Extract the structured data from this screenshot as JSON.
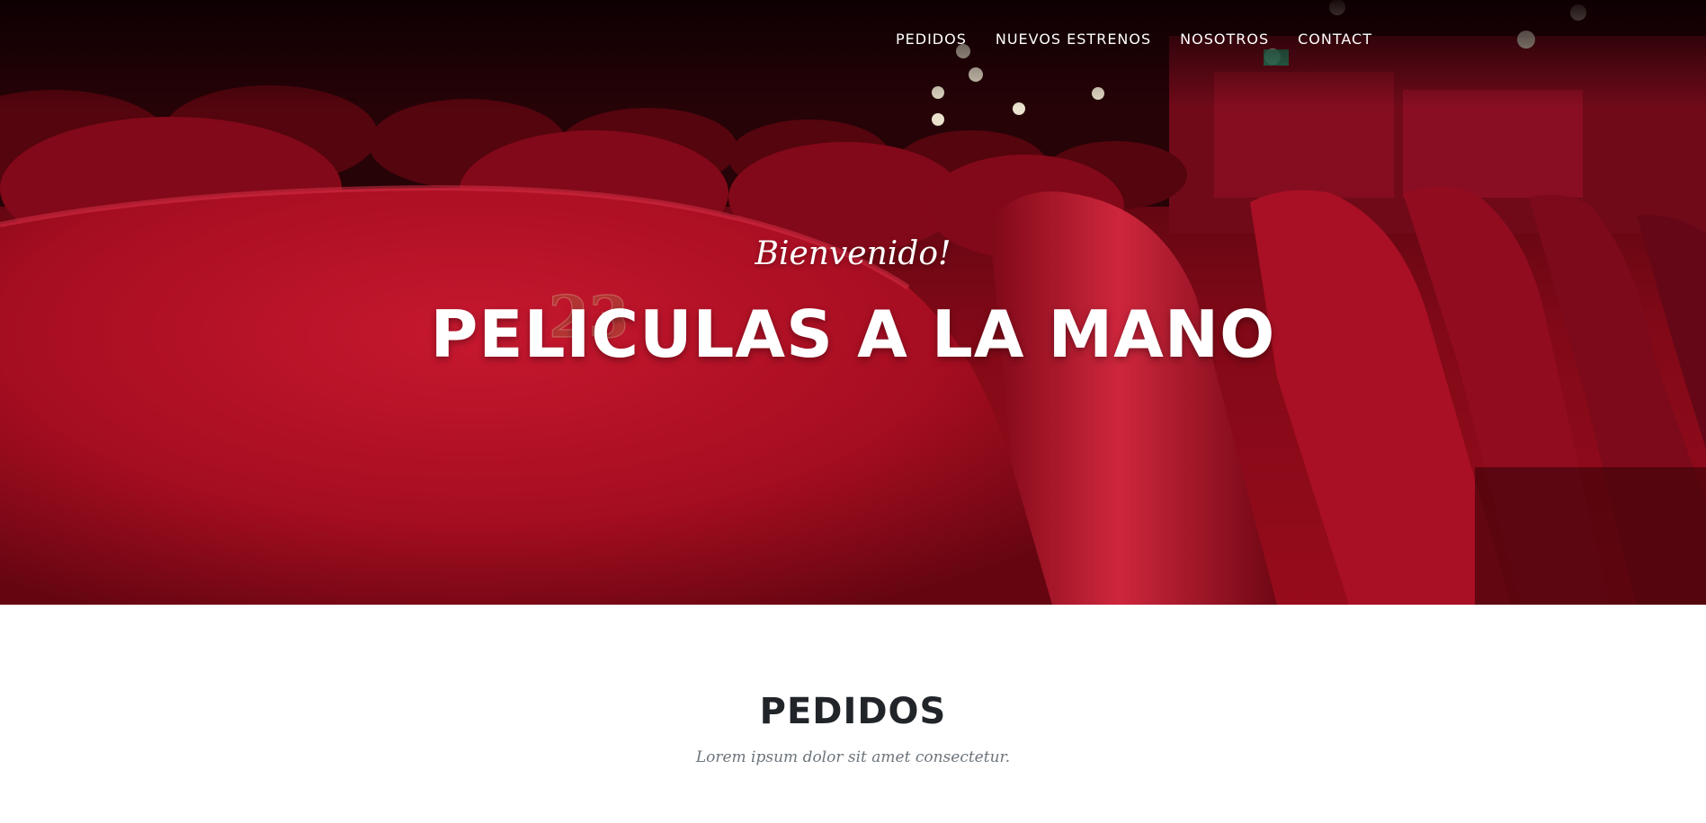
{
  "nav": {
    "items": [
      {
        "label": "PEDIDOS"
      },
      {
        "label": "NUEVOS ESTRENOS"
      },
      {
        "label": "NOSOTROS"
      },
      {
        "label": "CONTACT"
      }
    ]
  },
  "hero": {
    "subheading": "Bienvenido!",
    "heading": "PELICULAS A LA MANO",
    "seat_number": "23",
    "colors": {
      "seat_red": "#c4142b",
      "dark": "#1a0205"
    }
  },
  "pedidos": {
    "heading": "PEDIDOS",
    "subheading": "Lorem ipsum dolor sit amet consectetur."
  }
}
